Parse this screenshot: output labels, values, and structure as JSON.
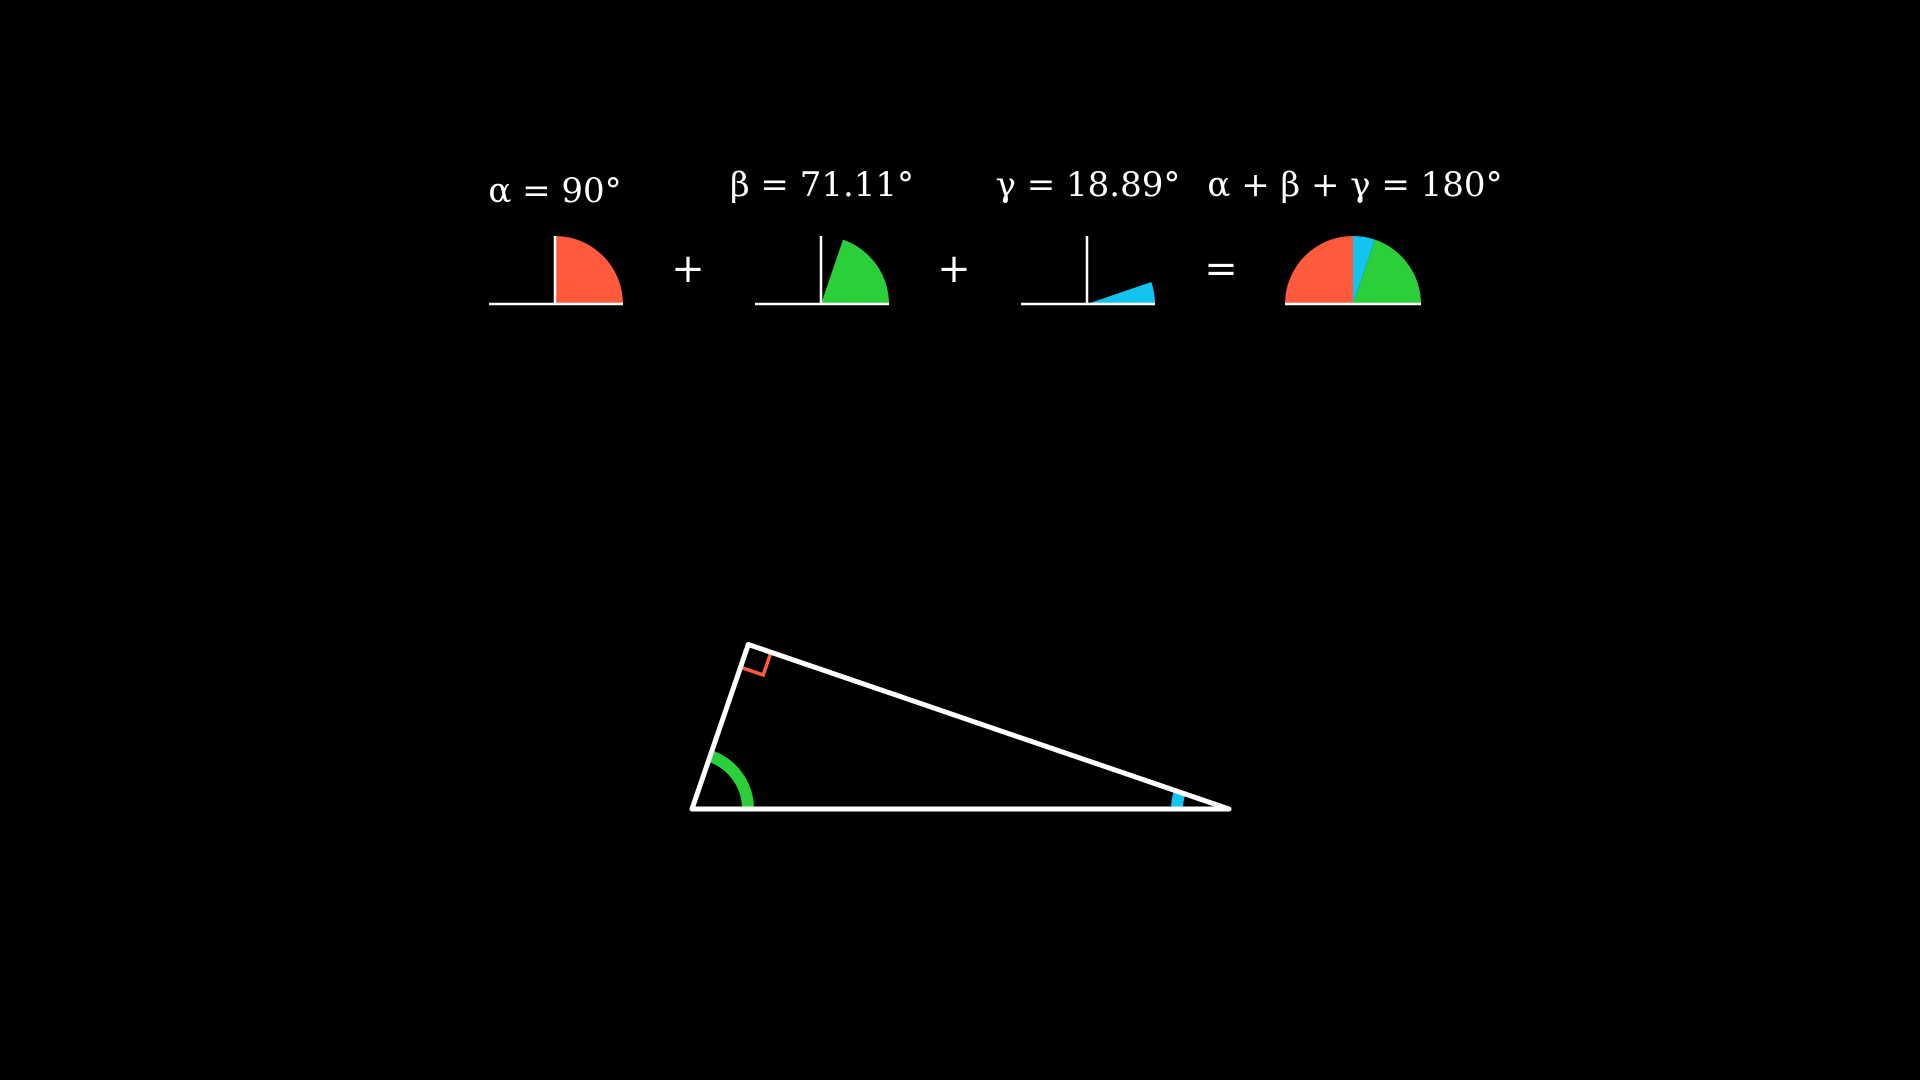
{
  "equation": {
    "alpha_label": "α = 90°",
    "beta_label": "β = 71.11°",
    "gamma_label": "γ = 18.89°",
    "sum_label": "α + β + γ = 180°",
    "plus_1": "+",
    "plus_2": "+",
    "equals": "="
  },
  "angles": {
    "alpha": 90,
    "beta": 71.11,
    "gamma": 18.89
  },
  "colors": {
    "alpha": "#FF5A3C",
    "beta": "#2ACF3A",
    "gamma": "#14C4F0",
    "line": "#FFFFFF",
    "background": "#000000"
  }
}
